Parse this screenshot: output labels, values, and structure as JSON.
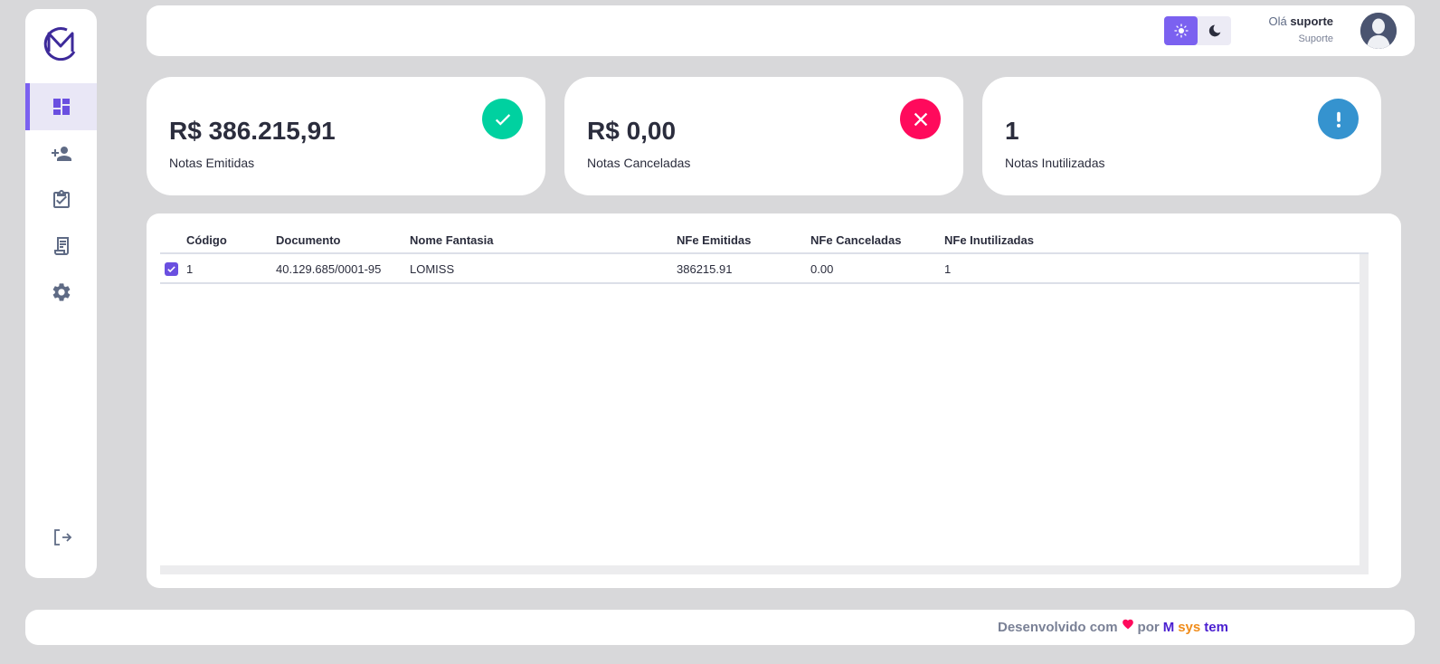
{
  "sidebar": {
    "items": [
      {
        "icon": "dashboard-icon",
        "active": true
      },
      {
        "icon": "add-user-icon",
        "active": false
      },
      {
        "icon": "clipboard-check-icon",
        "active": false
      },
      {
        "icon": "receipt-icon",
        "active": false
      },
      {
        "icon": "gear-icon",
        "active": false
      }
    ],
    "logout_icon": "logout-icon"
  },
  "header": {
    "greeting_prefix": "Olá",
    "username": "suporte",
    "role": "Suporte",
    "theme": "light"
  },
  "cards": [
    {
      "value": "R$ 386.215,91",
      "label": "Notas Emitidas",
      "icon": "check-icon",
      "color": "#00d1a0"
    },
    {
      "value": "R$ 0,00",
      "label": "Notas Canceladas",
      "icon": "close-icon",
      "color": "#ff0a5c"
    },
    {
      "value": "1",
      "label": "Notas Inutilizadas",
      "icon": "exclamation-icon",
      "color": "#3593cf"
    }
  ],
  "table": {
    "columns": [
      "Código",
      "Documento",
      "Nome Fantasia",
      "NFe Emitidas",
      "NFe Canceladas",
      "NFe Inutilizadas"
    ],
    "rows": [
      {
        "checked": true,
        "cells": [
          "1",
          "40.129.685/0001-95",
          "LOMISS",
          "386215.91",
          "0.00",
          "1"
        ]
      }
    ]
  },
  "footer": {
    "text": "Desenvolvido com",
    "por": "por",
    "brand_m": "M",
    "brand_sys": "sys",
    "brand_tem": "tem"
  },
  "colors": {
    "accent": "#7b61f0",
    "heart": "#ff0a5c"
  }
}
